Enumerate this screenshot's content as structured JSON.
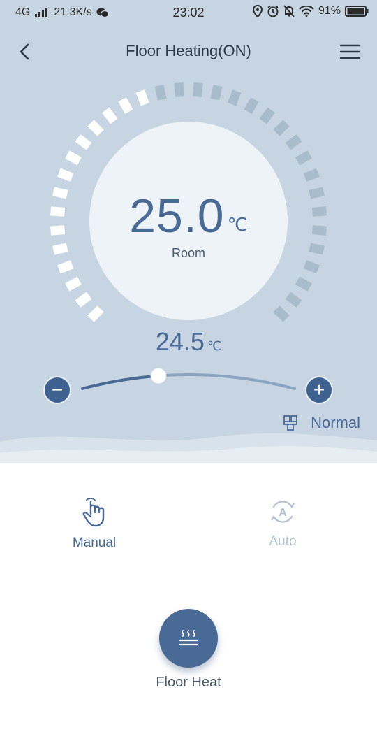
{
  "status_bar": {
    "network": "4G",
    "speed": "21.3K/s",
    "time": "23:02",
    "battery": "91%"
  },
  "header": {
    "title": "Floor Heating(ON)"
  },
  "thermostat": {
    "room_temp": "25.0",
    "room_unit": "℃",
    "room_label": "Room",
    "set_temp": "24.5",
    "set_unit": "℃",
    "slider_position": 0.36,
    "minus_label": "−",
    "plus_label": "+",
    "mode_label": "Normal"
  },
  "modes": {
    "manual_label": "Manual",
    "auto_label": "Auto",
    "active": "manual"
  },
  "action": {
    "label": "Floor Heat"
  },
  "colors": {
    "background_top": "#c6d5e1",
    "accent": "#4a6a96",
    "tick_active": "#ffffff",
    "tick_inactive": "#a9bccb"
  }
}
